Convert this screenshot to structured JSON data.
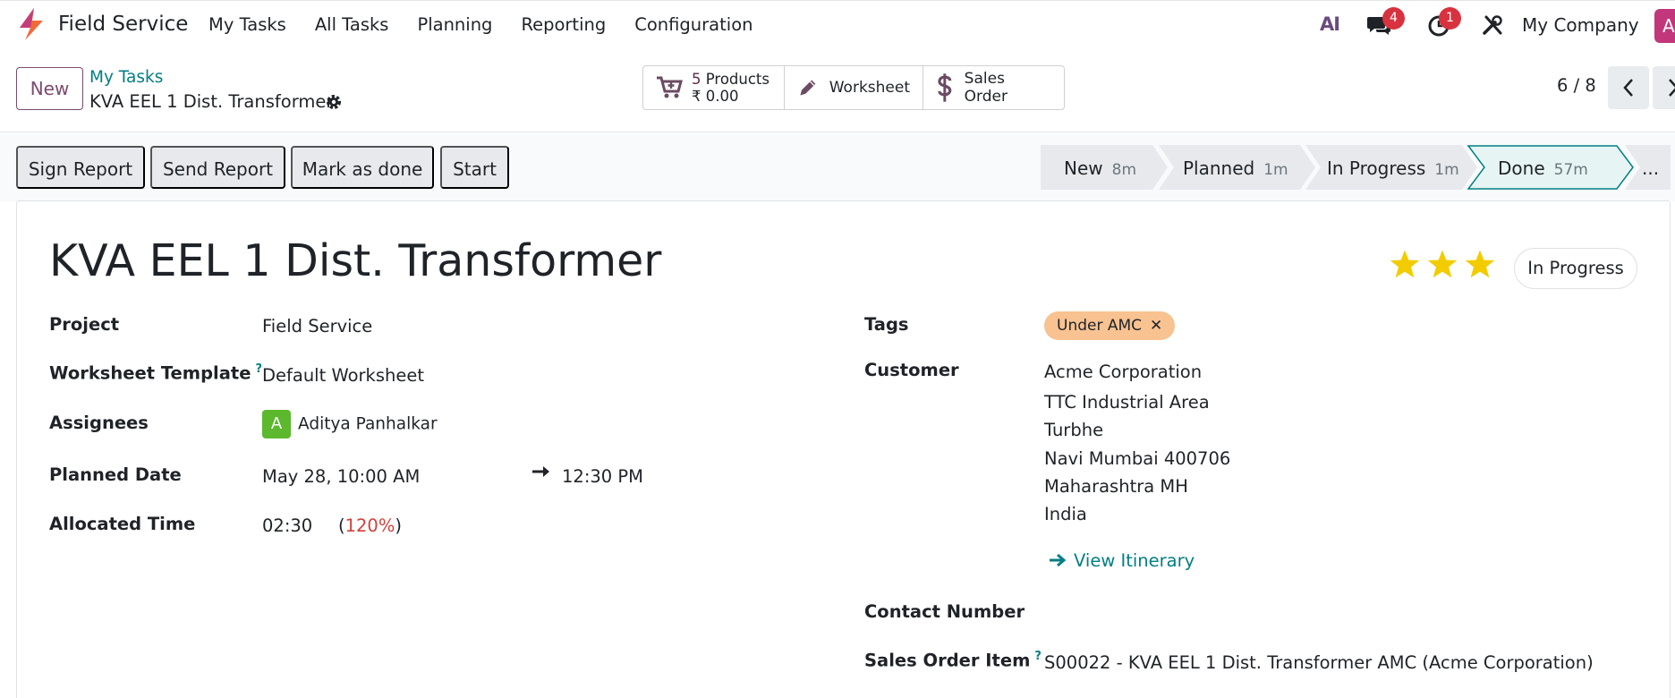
{
  "navbar": {
    "app_name": "Field Service",
    "menu": [
      "My Tasks",
      "All Tasks",
      "Planning",
      "Reporting",
      "Configuration"
    ],
    "ai_label": "AI",
    "chat_badge": "4",
    "activity_badge": "1",
    "company": "My Company",
    "user_initial": "A"
  },
  "control_panel": {
    "new_label": "New",
    "breadcrumb": "My Tasks",
    "record_name": "KVA EEL 1 Dist. Transformer",
    "smart_buttons": {
      "products_count": "5",
      "products_label": "Products",
      "products_amount": "₹ 0.00",
      "worksheet_label": "Worksheet",
      "sales_order_label": "Sales Order"
    },
    "pager": "6 / 8"
  },
  "actions": {
    "sign_report": "Sign Report",
    "send_report": "Send Report",
    "mark_done": "Mark as done",
    "start": "Start"
  },
  "stages": [
    {
      "name": "New",
      "time": "8m"
    },
    {
      "name": "Planned",
      "time": "1m"
    },
    {
      "name": "In Progress",
      "time": "1m"
    },
    {
      "name": "Done",
      "time": "57m"
    },
    {
      "name": "...",
      "time": ""
    }
  ],
  "form": {
    "title": "KVA EEL 1 Dist. Transformer",
    "priority_stars": 3,
    "state": "In Progress",
    "left": {
      "project_label": "Project",
      "project_value": "Field Service",
      "worksheet_label": "Worksheet Template",
      "worksheet_value": "Default Worksheet",
      "assignees_label": "Assignees",
      "assignee_initial": "A",
      "assignee_name": "Aditya Panhalkar",
      "planned_label": "Planned Date",
      "planned_start": "May 28, 10:00 AM",
      "planned_end": "12:30 PM",
      "allocated_label": "Allocated Time",
      "allocated_value": "02:30",
      "allocated_open": "(",
      "allocated_pct": "120%",
      "allocated_close": ")"
    },
    "right": {
      "tags_label": "Tags",
      "tag": "Under AMC",
      "customer_label": "Customer",
      "address": [
        "Acme Corporation",
        "TTC Industrial Area",
        "Turbhe",
        "Navi Mumbai 400706",
        "Maharashtra MH",
        "India"
      ],
      "itinerary": "View Itinerary",
      "contact_label": "Contact Number",
      "so_item_label": "Sales Order Item",
      "so_item_value": "S00022 - KVA EEL 1 Dist. Transformer AMC (Acme Corporation)"
    },
    "help_mark": "?"
  },
  "colors": {
    "brand": "#7a4a6e",
    "link": "#017e84",
    "badge": "#d9323f",
    "star": "#f3cc00",
    "tag": "#f8c291",
    "danger": "#d23f3a"
  }
}
